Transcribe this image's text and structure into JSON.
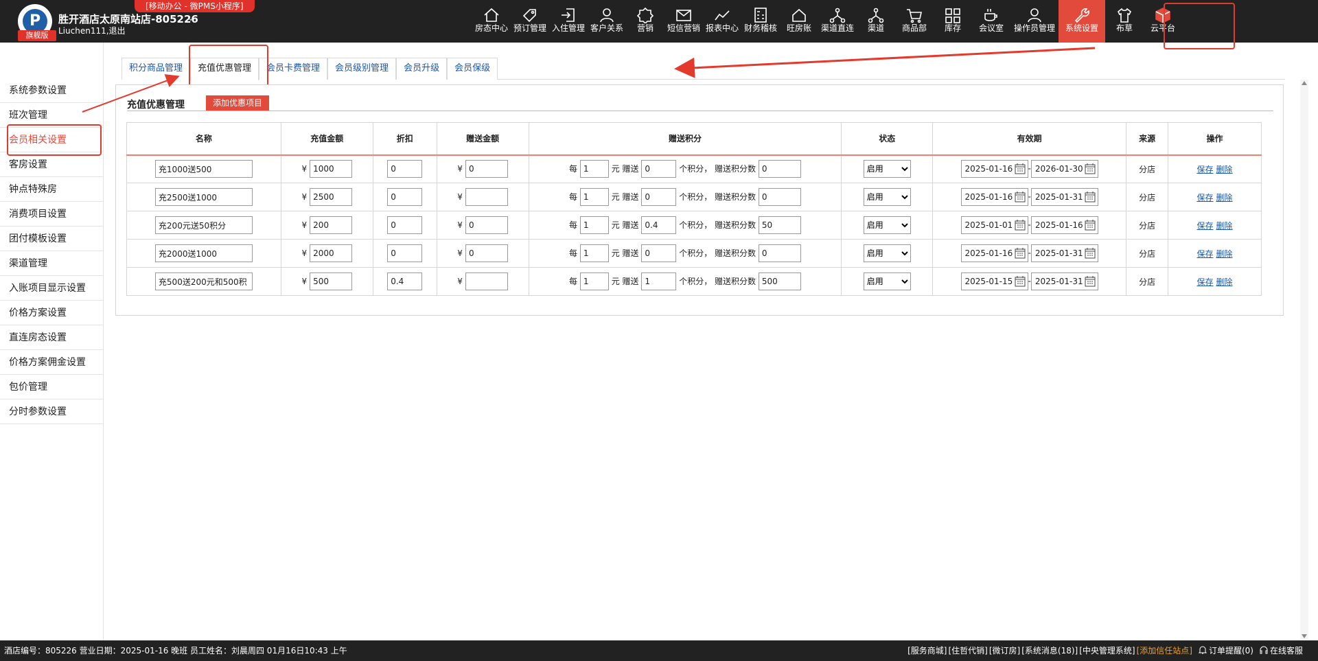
{
  "header": {
    "logo_letter": "P",
    "edition_label": "旗舰版",
    "hotel_name": "胜开酒店太原南站店-805226",
    "user_name": "Liuchen111",
    "logout_label": ",退出",
    "mobile_badge": "[移动办公 - 微PMS小程序]"
  },
  "nav": [
    {
      "label": "房态中心",
      "icon": "home-icon"
    },
    {
      "label": "预订管理",
      "icon": "tag-icon"
    },
    {
      "label": "入住管理",
      "icon": "checkin-icon"
    },
    {
      "label": "客户关系",
      "icon": "customer-icon"
    },
    {
      "label": "营销",
      "icon": "sale-icon"
    },
    {
      "label": "短信营销",
      "icon": "mail-icon"
    },
    {
      "label": "报表中心",
      "icon": "chart-line-icon"
    },
    {
      "label": "财务稽核",
      "icon": "calculator-icon"
    },
    {
      "label": "旺房账",
      "icon": "house-icon"
    },
    {
      "label": "渠道直连",
      "icon": "network-icon"
    },
    {
      "label": "渠道",
      "icon": "network-icon"
    },
    {
      "label": "商品部",
      "icon": "cart-icon"
    },
    {
      "label": "库存",
      "icon": "grid-icon"
    },
    {
      "label": "会议室",
      "icon": "cup-icon"
    },
    {
      "label": "操作员管理",
      "icon": "user-icon"
    },
    {
      "label": "系统设置",
      "icon": "wrench-icon",
      "active": true
    },
    {
      "label": "布草",
      "icon": "shirt-icon"
    },
    {
      "label": "云平台",
      "icon": "cube-icon"
    }
  ],
  "sidebar": {
    "items": [
      {
        "label": "系统参数设置"
      },
      {
        "label": "班次管理"
      },
      {
        "label": "会员相关设置",
        "active": true
      },
      {
        "label": "客房设置"
      },
      {
        "label": "钟点特殊房"
      },
      {
        "label": "消费项目设置"
      },
      {
        "label": "团付模板设置"
      },
      {
        "label": "渠道管理"
      },
      {
        "label": "入账项目显示设置"
      },
      {
        "label": "价格方案设置"
      },
      {
        "label": "直连房态设置"
      },
      {
        "label": "价格方案佣金设置"
      },
      {
        "label": "包价管理"
      },
      {
        "label": "分时参数设置"
      }
    ]
  },
  "tabs": [
    {
      "label": "积分商品管理"
    },
    {
      "label": "充值优惠管理",
      "active": true
    },
    {
      "label": "会员卡费管理"
    },
    {
      "label": "会员级别管理"
    },
    {
      "label": "会员升级"
    },
    {
      "label": "会员保级"
    }
  ],
  "panel": {
    "title": "充值优惠管理",
    "add_button": "添加优惠项目",
    "columns": [
      "名称",
      "充值金额",
      "折扣",
      "赠送金额",
      "赠送积分",
      "状态",
      "有效期",
      "来源",
      "操作"
    ],
    "currency": "¥",
    "points_text": {
      "every": "每",
      "yuan_gift": "元 赠送",
      "points_gift": "个积分，  赠送积分数"
    },
    "date_sep": "-",
    "save_label": "保存",
    "delete_label": "删除",
    "rows": [
      {
        "name": "充1000送500",
        "amount": "1000",
        "discount": "0",
        "gift": "0",
        "per": "1",
        "pts": "0",
        "gift_pts": "0",
        "status": "启用",
        "start": "2025-01-16",
        "end": "2026-01-30",
        "source": "分店"
      },
      {
        "name": "充2500送1000",
        "amount": "2500",
        "discount": "0",
        "gift": "",
        "per": "1",
        "pts": "0",
        "gift_pts": "0",
        "status": "启用",
        "start": "2025-01-16",
        "end": "2025-01-31",
        "source": "分店"
      },
      {
        "name": "充200元送50积分",
        "amount": "200",
        "discount": "0",
        "gift": "0",
        "per": "1",
        "pts": "0.4",
        "gift_pts": "50",
        "status": "启用",
        "start": "2025-01-01",
        "end": "2025-01-16",
        "source": "分店"
      },
      {
        "name": "充2000送1000",
        "amount": "2000",
        "discount": "0",
        "gift": "0",
        "per": "1",
        "pts": "0",
        "gift_pts": "0",
        "status": "启用",
        "start": "2025-01-16",
        "end": "2025-01-31",
        "source": "分店"
      },
      {
        "name": "充500送200元和500积",
        "amount": "500",
        "discount": "0.4",
        "gift": "",
        "per": "1",
        "pts": "1",
        "gift_pts": "500",
        "status": "启用",
        "start": "2025-01-15",
        "end": "2025-01-31",
        "source": "分店"
      }
    ]
  },
  "footer": {
    "left": "酒店编号：805226   营业日期：2025-01-16   晚班   员工姓名：刘晨周四 01月16日10:43 上午",
    "links": [
      "[服务商城]",
      "[住哲代销]",
      "[微订房]",
      "[系统消息(18)]",
      "[中央管理系统]"
    ],
    "highlight_link": "[添加信任站点]",
    "order_alert": "订单提醒(0)",
    "online_service": "在线客服"
  }
}
